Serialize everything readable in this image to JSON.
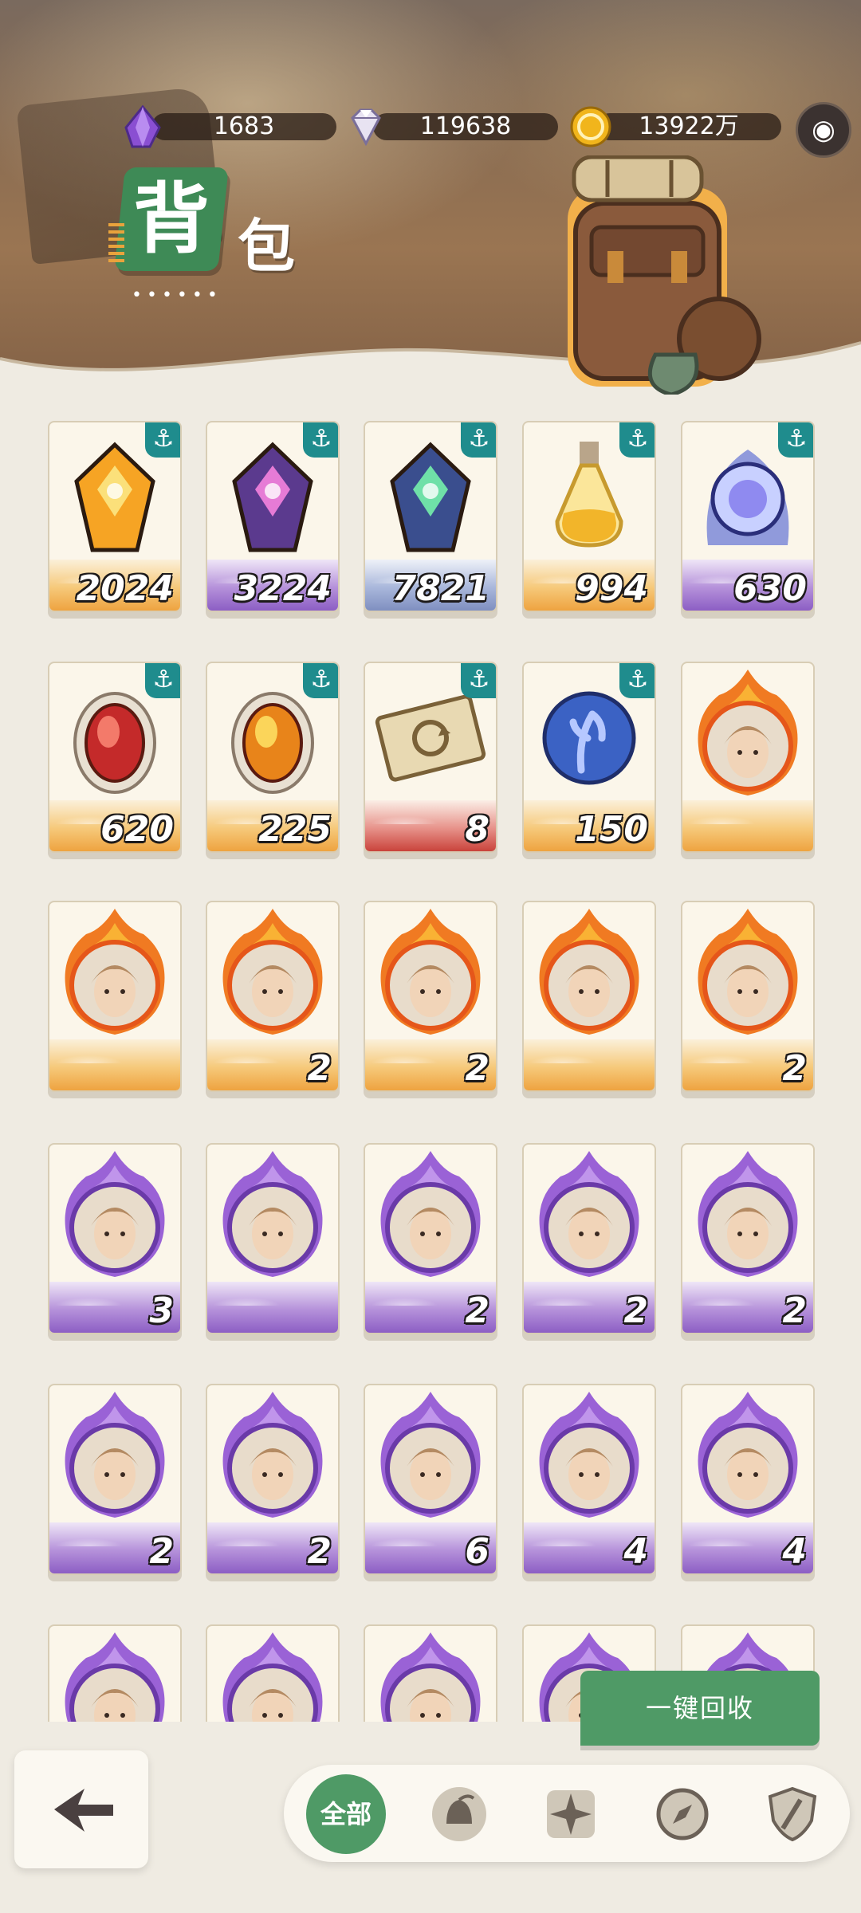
{
  "currencies": [
    {
      "name": "purple-crystal-icon",
      "value": "1683"
    },
    {
      "name": "diamond-icon",
      "value": "119638"
    },
    {
      "name": "gold-coin-icon",
      "value": "13922万"
    }
  ],
  "title": {
    "main": "背",
    "sub": "包",
    "dots": "••••••"
  },
  "rows": [
    [
      {
        "kind": "item",
        "icon": "orange-gem-icon",
        "count": "2024",
        "band": "orange",
        "anchor": true
      },
      {
        "kind": "item",
        "icon": "purple-gem-icon",
        "count": "3224",
        "band": "purple",
        "anchor": true
      },
      {
        "kind": "item",
        "icon": "blue-gem-icon",
        "count": "7821",
        "band": "blue",
        "anchor": true
      },
      {
        "kind": "item",
        "icon": "potion-bottle-icon",
        "count": "994",
        "band": "orange",
        "anchor": true
      },
      {
        "kind": "item",
        "icon": "blue-orb-icon",
        "count": "630",
        "band": "purple",
        "anchor": true
      }
    ],
    [
      {
        "kind": "item",
        "icon": "red-egg-gem-icon",
        "count": "620",
        "band": "orange",
        "anchor": true
      },
      {
        "kind": "item",
        "icon": "gold-egg-gem-icon",
        "count": "225",
        "band": "orange",
        "anchor": true
      },
      {
        "kind": "item",
        "icon": "ticket-icon",
        "count": "8",
        "band": "red",
        "anchor": true
      },
      {
        "kind": "item",
        "icon": "blue-coin-icon",
        "count": "150",
        "band": "orange",
        "anchor": true
      },
      {
        "kind": "hero",
        "icon": "hero-fire-white-hair-icon",
        "count": "",
        "band": "orange",
        "anchor": false
      }
    ],
    [
      {
        "kind": "hero",
        "icon": "hero-fire-girl-icon",
        "count": "",
        "band": "orange",
        "anchor": false
      },
      {
        "kind": "hero",
        "icon": "hero-fire-pink-hair-icon",
        "count": "2",
        "band": "orange",
        "anchor": false
      },
      {
        "kind": "hero",
        "icon": "hero-fire-blonde-icon",
        "count": "2",
        "band": "orange",
        "anchor": false
      },
      {
        "kind": "hero",
        "icon": "hero-fire-beast-icon",
        "count": "",
        "band": "orange",
        "anchor": false
      },
      {
        "kind": "hero",
        "icon": "hero-fire-armored-icon",
        "count": "2",
        "band": "orange",
        "anchor": false
      }
    ],
    [
      {
        "kind": "hero",
        "icon": "hero-purple-old-man-icon",
        "count": "3",
        "band": "purple",
        "anchor": false
      },
      {
        "kind": "hero",
        "icon": "hero-purple-bearded-icon",
        "count": "",
        "band": "purple",
        "anchor": false
      },
      {
        "kind": "hero",
        "icon": "hero-purple-tree-icon",
        "count": "2",
        "band": "purple",
        "anchor": false
      },
      {
        "kind": "hero",
        "icon": "hero-purple-dark-hair-icon",
        "count": "2",
        "band": "purple",
        "anchor": false
      },
      {
        "kind": "hero",
        "icon": "hero-purple-pirate-icon",
        "count": "2",
        "band": "purple",
        "anchor": false
      }
    ],
    [
      {
        "kind": "hero",
        "icon": "hero-purple-girl-icon",
        "count": "2",
        "band": "purple",
        "anchor": false
      },
      {
        "kind": "hero",
        "icon": "hero-purple-crowned-icon",
        "count": "2",
        "band": "purple",
        "anchor": false
      },
      {
        "kind": "hero",
        "icon": "hero-purple-eyepatch-icon",
        "count": "6",
        "band": "purple",
        "anchor": false
      },
      {
        "kind": "hero",
        "icon": "hero-purple-white-hair-icon",
        "count": "4",
        "band": "purple",
        "anchor": false
      },
      {
        "kind": "hero",
        "icon": "hero-purple-demon-icon",
        "count": "4",
        "band": "purple",
        "anchor": false
      }
    ],
    [
      {
        "kind": "hero",
        "icon": "hero-purple-icon",
        "count": "",
        "band": "purple",
        "anchor": false
      },
      {
        "kind": "hero",
        "icon": "hero-purple-icon",
        "count": "",
        "band": "purple",
        "anchor": false
      },
      {
        "kind": "hero",
        "icon": "hero-purple-icon",
        "count": "",
        "band": "purple",
        "anchor": false
      },
      {
        "kind": "hero",
        "icon": "hero-purple-icon",
        "count": "",
        "band": "purple",
        "anchor": false
      },
      {
        "kind": "hero",
        "icon": "hero-purple-icon",
        "count": "",
        "band": "purple",
        "anchor": false
      }
    ]
  ],
  "recycle_label": "一键回收",
  "tabs": {
    "all_label": "全部",
    "icons": [
      "helmet-tab-icon",
      "star-compass-tab-icon",
      "compass-tab-icon",
      "shield-tab-icon"
    ]
  },
  "colors": {
    "accent_green": "#4f9a66",
    "anchor_teal": "#1f8c8d"
  }
}
